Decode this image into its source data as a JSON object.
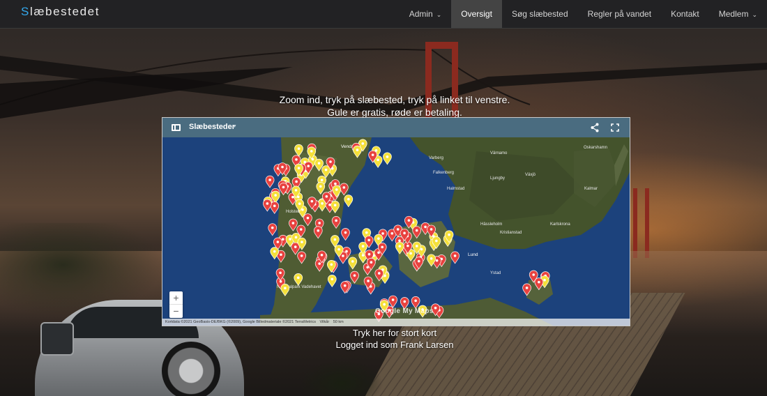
{
  "brand": {
    "first_letter": "S",
    "rest": "læbestedet"
  },
  "nav": {
    "items": [
      {
        "label": "Admin",
        "has_caret": true,
        "active": false
      },
      {
        "label": "Oversigt",
        "has_caret": false,
        "active": true
      },
      {
        "label": "Søg slæbested",
        "has_caret": false,
        "active": false
      },
      {
        "label": "Regler på vandet",
        "has_caret": false,
        "active": false
      },
      {
        "label": "Kontakt",
        "has_caret": false,
        "active": false
      },
      {
        "label": "Medlem",
        "has_caret": true,
        "active": false
      }
    ]
  },
  "instructions": {
    "line1": "Zoom ind, tryk på slæbested, tryk på linket til venstre.",
    "line2": "Gule er gratis, røde er betaling."
  },
  "map": {
    "title": "Slæbesteder",
    "icons": {
      "sidebar": "sidebar-toggle-icon",
      "share": "share-icon",
      "fullscreen": "fullscreen-icon"
    },
    "zoom_in": "+",
    "zoom_out": "−",
    "google": "Google My Maps",
    "attribution": [
      "Kortdata ©2021 GeoBasis-DE/BKG (©2009), Google Billedmateriale ©2021 TerraMetrics",
      "Vilkår",
      "50 km"
    ],
    "place_labels": [
      "Vendsyssel",
      "Varberg",
      "Värnamo",
      "Oskarshamn",
      "Falkenberg",
      "Växjö",
      "Ljungby",
      "Halmstad",
      "Kalmar",
      "Holstebro",
      "Hässleholm",
      "Kristianstad",
      "Karlskrona",
      "Lund",
      "Ystad",
      "Nationalpark Vadehavet"
    ],
    "marker_colors": {
      "paid": "#e8423f",
      "free": "#f5e03a"
    }
  },
  "footer": {
    "big_map_link": "Tryk her for stort kort",
    "logged_in": "Logget ind som Frank Larsen"
  }
}
